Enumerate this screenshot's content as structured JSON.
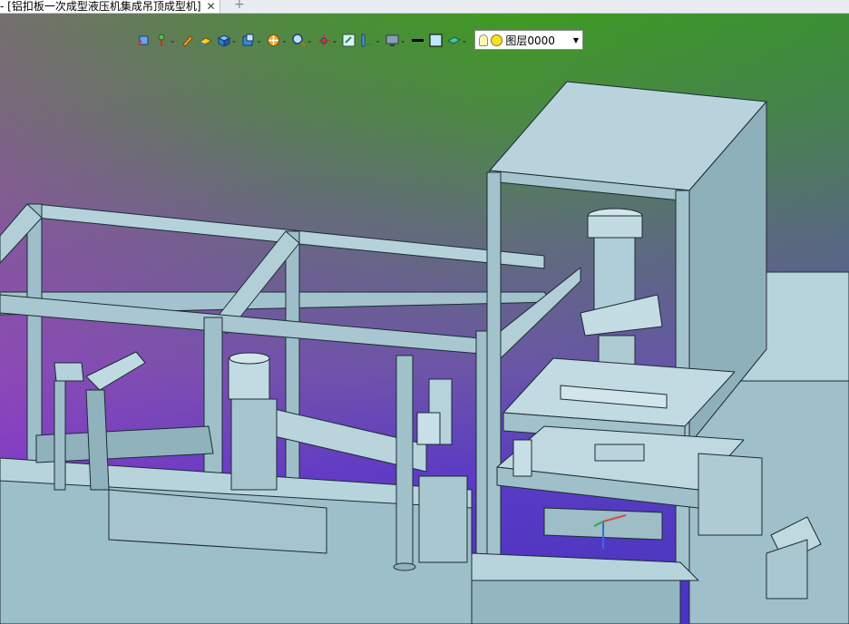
{
  "tab": {
    "title": "- [铝扣板一次成型液压机集成吊顶成型机]",
    "close_symbol": "✕",
    "new_tab_symbol": "+"
  },
  "toolbar": {
    "tools": [
      {
        "icon": "view-orient-icon",
        "dropdown": false
      },
      {
        "icon": "pin-icon",
        "dropdown": true
      },
      {
        "icon": "pencil-icon",
        "dropdown": false
      },
      {
        "icon": "solid-layer-icon",
        "dropdown": false
      },
      {
        "icon": "cube-icon",
        "dropdown": true
      },
      {
        "icon": "section-view-icon",
        "dropdown": true
      },
      {
        "icon": "render-sphere-icon",
        "dropdown": true
      },
      {
        "icon": "zoom-icon",
        "dropdown": true
      },
      {
        "icon": "axis-icon",
        "dropdown": true
      },
      {
        "icon": "fit-view-icon",
        "dropdown": false
      },
      {
        "icon": "measure-icon",
        "dropdown": true
      },
      {
        "icon": "monitor-icon",
        "dropdown": true
      },
      {
        "icon": "line-style-icon",
        "dropdown": false
      },
      {
        "icon": "color-square-icon",
        "dropdown": false
      },
      {
        "icon": "plane-icon",
        "dropdown": true
      }
    ],
    "layer_select": {
      "value": "图层0000",
      "arrow": "▼"
    }
  },
  "viewport": {
    "colors": {
      "top": "#3f9a23",
      "middle": "#6a56a6",
      "bottom": "#4b31c4",
      "model": "#a9c9d3",
      "edge": "#1d2b33"
    }
  }
}
